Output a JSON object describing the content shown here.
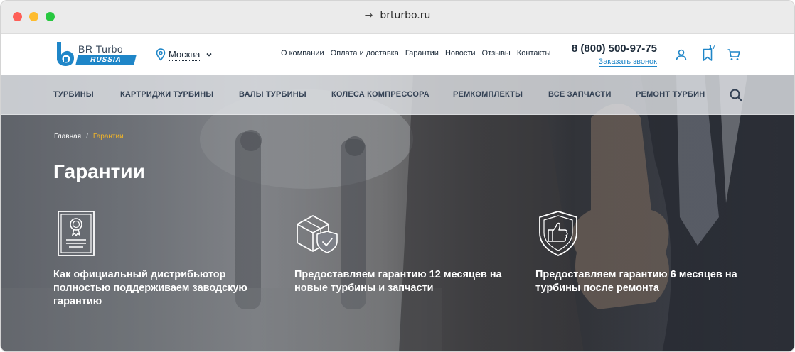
{
  "browser": {
    "url": "brturbo.ru"
  },
  "header": {
    "logo_text": "BR Turbo",
    "logo_sub": "RUSSIA",
    "city": "Москва",
    "top_nav": [
      "О компании",
      "Оплата и доставка",
      "Гарантии",
      "Новости",
      "Отзывы",
      "Контакты"
    ],
    "phone": "8 (800) 500-97-75",
    "callback_label": "Заказать звонок",
    "favorites_count": "17"
  },
  "main_nav": [
    "ТУРБИНЫ",
    "КАРТРИДЖИ ТУРБИНЫ",
    "ВАЛЫ ТУРБИНЫ",
    "КОЛЕСА КОМПРЕССОРА",
    "РЕМКОМПЛЕКТЫ",
    "ВСЕ ЗАПЧАСТИ",
    "РЕМОНТ ТУРБИН"
  ],
  "breadcrumb": {
    "home": "Главная",
    "separator": "/",
    "current": "Гарантии"
  },
  "page_title": "Гарантии",
  "features": [
    {
      "icon": "certificate-icon",
      "text": "Как официальный дистрибьютор полностью поддерживаем заводскую гарантию"
    },
    {
      "icon": "box-shield-icon",
      "text": "Предоставляем гарантию 12 месяцев на новые турбины и запчасти"
    },
    {
      "icon": "thumbs-up-shield-icon",
      "text": "Предоставляем гарантию 6 месяцев на турбины после ремонта"
    }
  ],
  "colors": {
    "accent": "#1f86c8",
    "breadcrumb_current": "#f0b429",
    "text_dark": "#1d2b3a"
  }
}
